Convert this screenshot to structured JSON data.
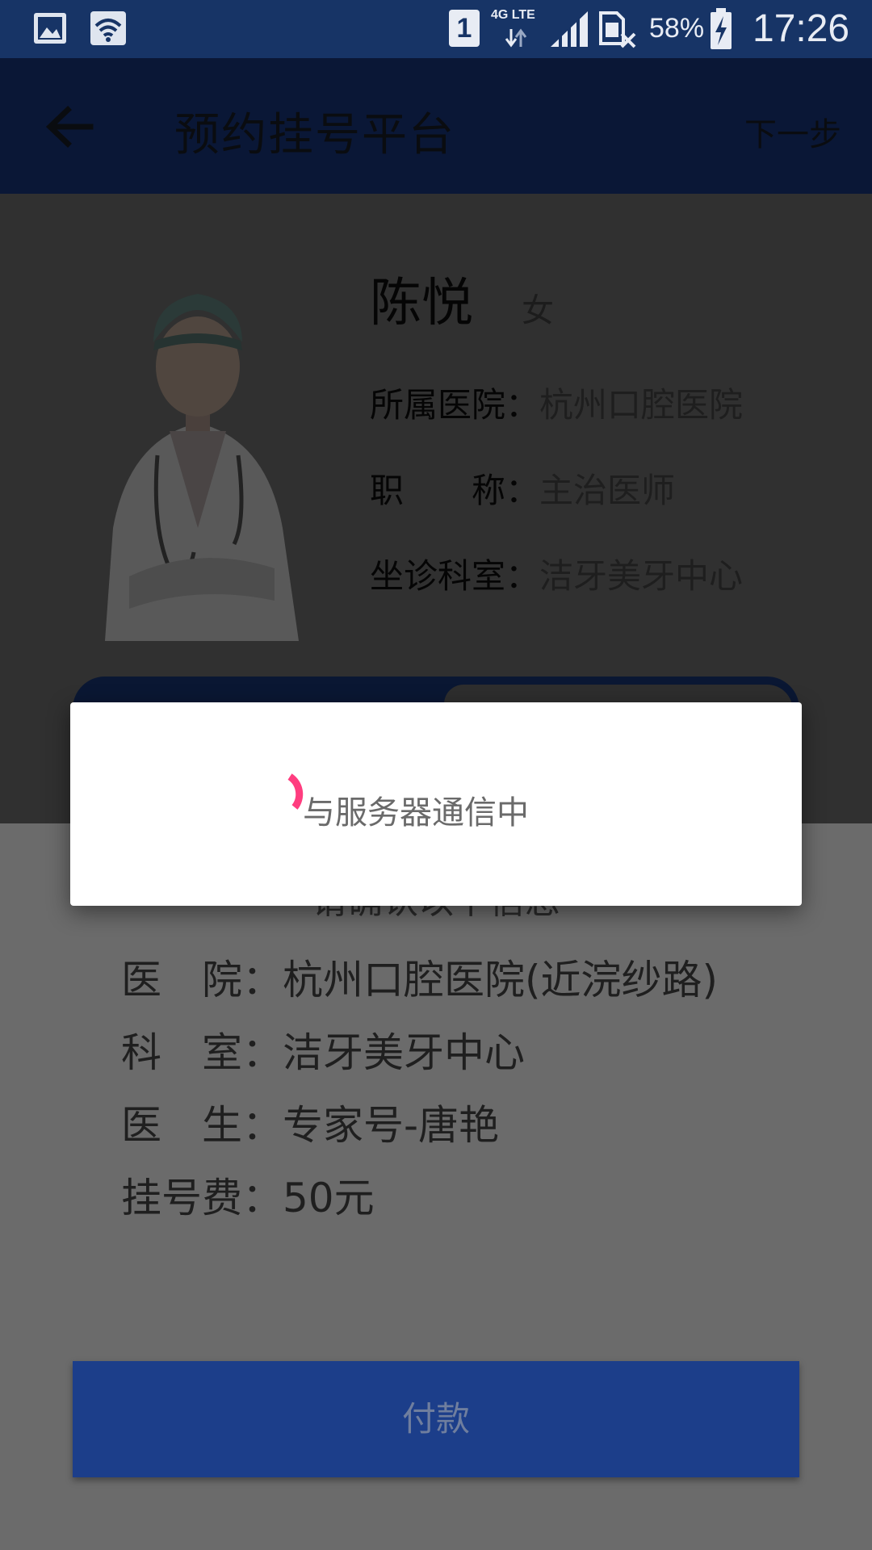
{
  "status_bar": {
    "sim_badge": "1",
    "network_type": "4G LTE",
    "battery": "58%",
    "time": "17:26"
  },
  "app_bar": {
    "title": "预约挂号平台",
    "next_label": "下一步"
  },
  "doctor": {
    "name": "陈悦",
    "gender": "女",
    "hospital_label": "所属医院：",
    "hospital": "杭州口腔医院",
    "title_label": "职　　称：",
    "title": "主治医师",
    "dept_label": "坐诊科室：",
    "dept": "洁牙美牙中心"
  },
  "confirm": {
    "heading": "请确认以下信息",
    "rows": [
      {
        "label": "医　院：",
        "value": "杭州口腔医院(近浣纱路)"
      },
      {
        "label": "科　室：",
        "value": "洁牙美牙中心"
      },
      {
        "label": "医　生：",
        "value": "专家号-唐艳"
      },
      {
        "label": "挂号费：",
        "value": "50元"
      }
    ],
    "pay_label": "付款"
  },
  "dialog": {
    "message": "与服务器通信中"
  },
  "colors": {
    "status_bar": "#173466",
    "pay_button": "#1c3e8a",
    "spinner": "#ff3d7f"
  }
}
